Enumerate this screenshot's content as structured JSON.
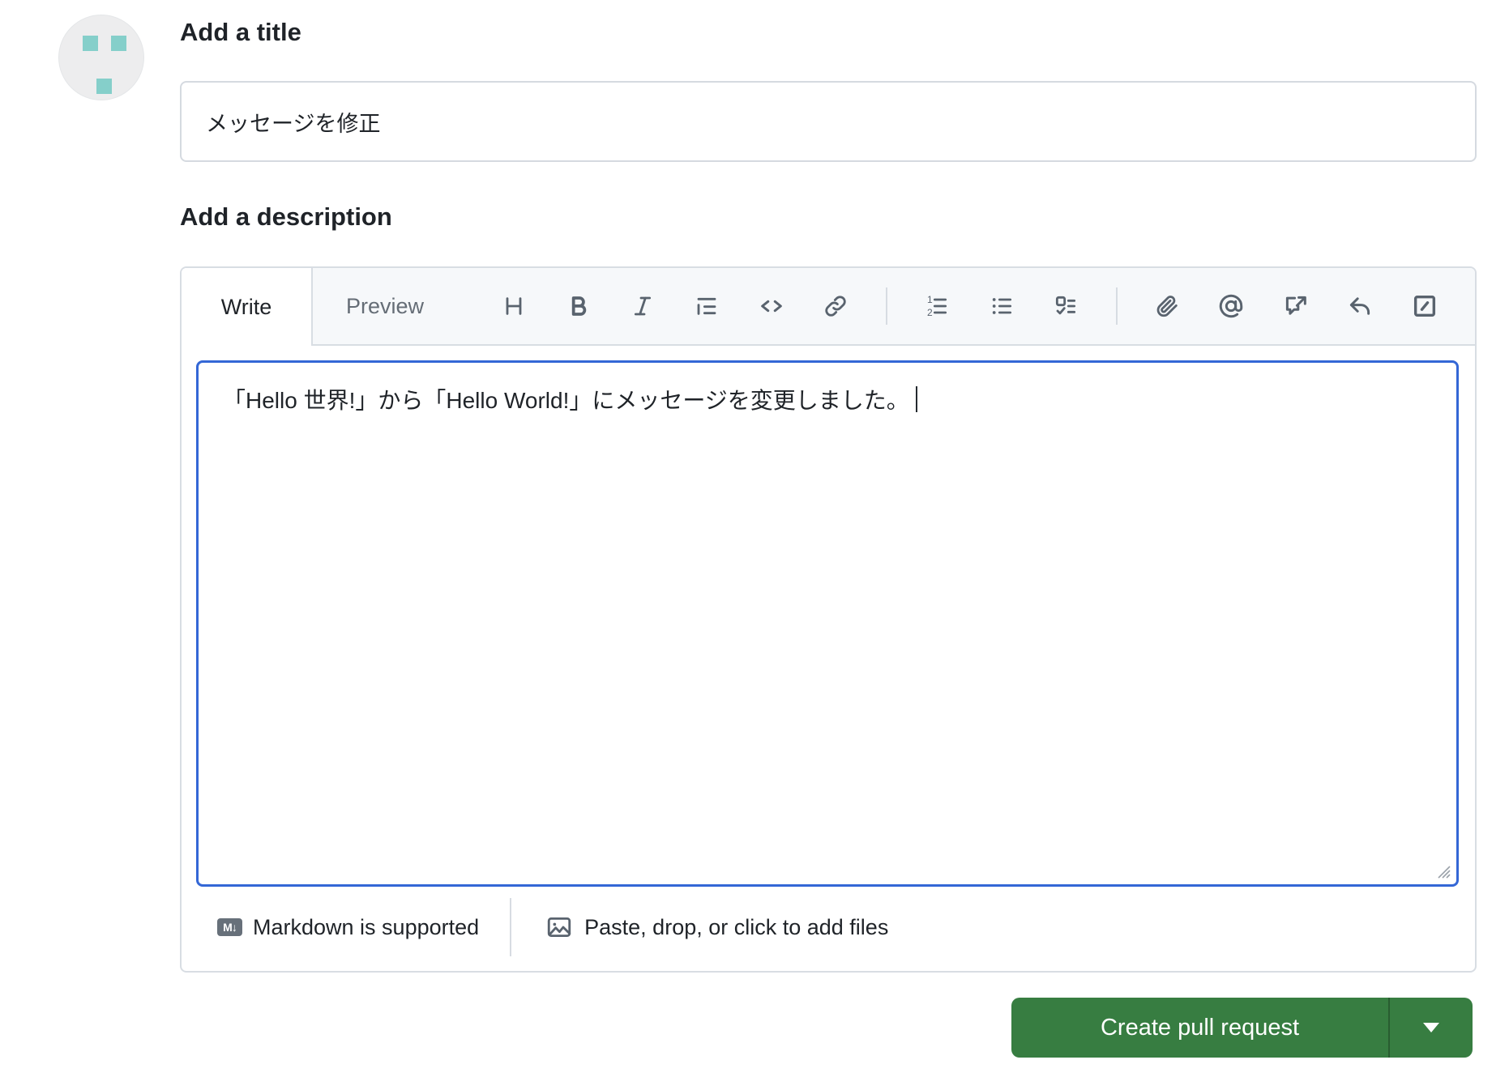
{
  "avatar": {
    "kind": "identicon",
    "bg": "#ededee",
    "square_color": "#85cfca"
  },
  "title_section": {
    "heading": "Add a title",
    "input_value": "メッセージを修正"
  },
  "description_section": {
    "heading": "Add a description",
    "tabs": {
      "write": "Write",
      "preview": "Preview"
    },
    "toolbar_icons": [
      "heading",
      "bold",
      "italic",
      "quote",
      "code",
      "link",
      "numbered-list",
      "unordered-list",
      "task-list",
      "attachment",
      "mention",
      "cross-reference",
      "reply",
      "slash-command"
    ],
    "editor_text": "「Hello 世界!」から「Hello World!」にメッセージを変更しました。",
    "footer": {
      "markdown_badge": "M↓",
      "markdown_note": "Markdown is supported",
      "attach_label": "Paste, drop, or click to add files"
    }
  },
  "actions": {
    "create_label": "Create pull request"
  },
  "colors": {
    "accent_green": "#377d41",
    "focus_blue": "#3467d6",
    "avatar_teal": "#85cfca",
    "header_bg": "#f6f8fa",
    "border": "#d8dde3",
    "icon_gray": "#59636e",
    "muted_text": "#656d76",
    "text": "#1f2328"
  }
}
